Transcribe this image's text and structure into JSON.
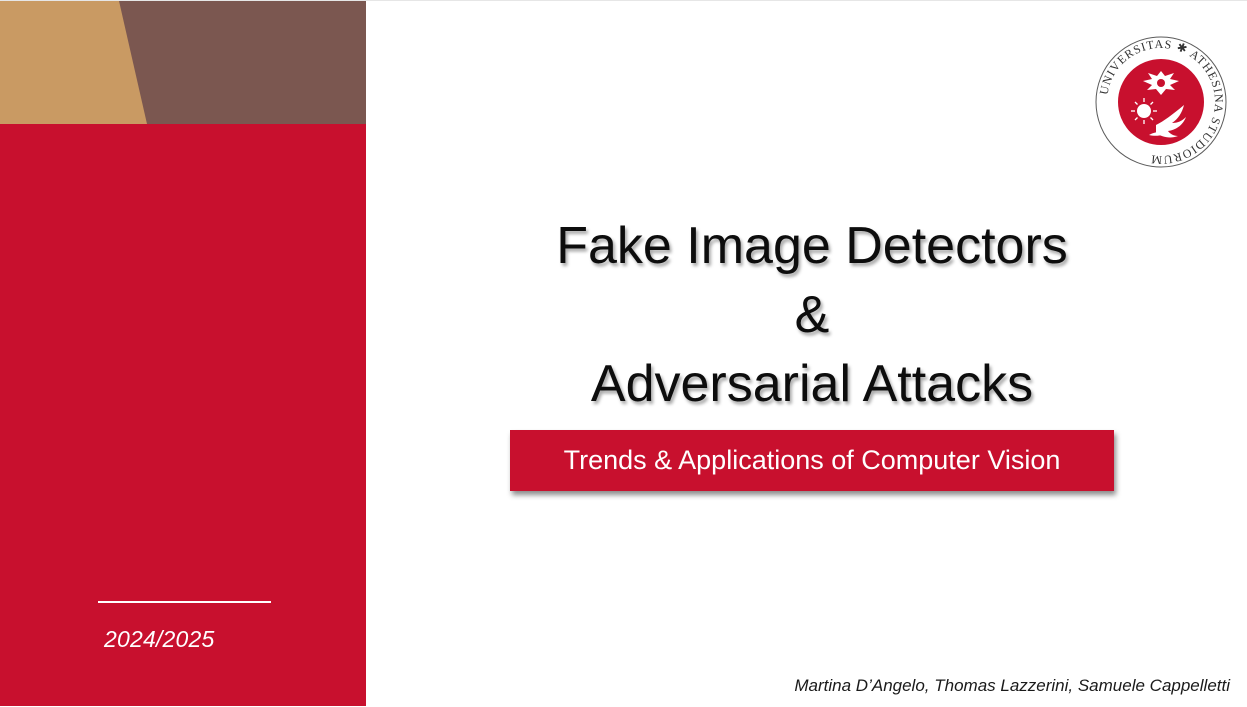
{
  "slide": {
    "title_lines": [
      "Fake Image Detectors",
      "&",
      "Adversarial Attacks"
    ],
    "subtitle": "Trends & Applications of Computer Vision",
    "academic_year": "2024/2025",
    "authors": "Martina D’Angelo, Thomas Lazzerini, Samuele Cappelletti"
  },
  "logo": {
    "seal_text": "UNIVERSITAS ✱ ATHESINA STUDIORUM",
    "icon": "university-seal-icon"
  },
  "colors": {
    "brand_red": "#c8102e",
    "band_tan": "#c99a63",
    "band_brown": "#7b5750",
    "text_dark": "#0d0d0d",
    "white": "#ffffff"
  }
}
